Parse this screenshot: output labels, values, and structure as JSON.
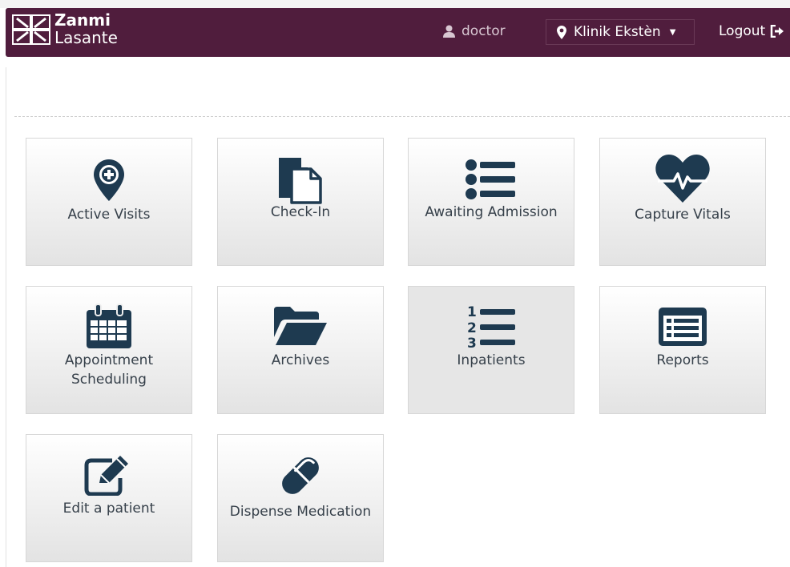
{
  "brand": {
    "line1": "Zanmi",
    "line2": "Lasante"
  },
  "header": {
    "user": "doctor",
    "location": "Klinik Ekstèn",
    "logout": "Logout"
  },
  "colors": {
    "header_bg": "#501d3d",
    "icon": "#1e3a50"
  },
  "apps": [
    {
      "label": "Active Visits",
      "icon": "map-marker-plus-icon"
    },
    {
      "label": "Check-In",
      "icon": "documents-icon"
    },
    {
      "label": "Awaiting Admission",
      "icon": "list-icon"
    },
    {
      "label": "Capture Vitals",
      "icon": "heartbeat-icon"
    },
    {
      "label": "Appointment Scheduling",
      "icon": "calendar-icon"
    },
    {
      "label": "Archives",
      "icon": "folder-open-icon"
    },
    {
      "label": "Inpatients",
      "icon": "ordered-list-icon"
    },
    {
      "label": "Reports",
      "icon": "report-list-icon"
    },
    {
      "label": "Edit a patient",
      "icon": "edit-icon"
    },
    {
      "label": "Dispense Medication",
      "icon": "pill-icon"
    }
  ]
}
